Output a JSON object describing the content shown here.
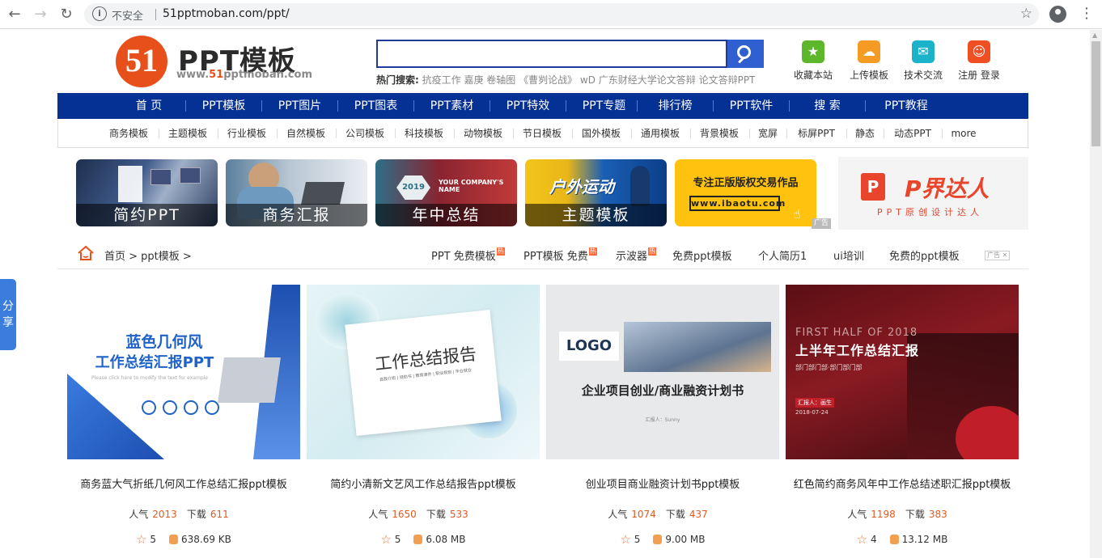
{
  "browser": {
    "security_label": "不安全",
    "url": "51pptmoban.com/ppt/"
  },
  "header": {
    "logo_mark": "51",
    "logo_title": "PPT模板",
    "logo_sub_prefix": "www.",
    "logo_sub_highlight": "51",
    "logo_sub_suffix": "pptmoban.com",
    "hot_label": "热门搜索:",
    "hot_terms": "抗疫工作 嘉庚 卷轴图 《曹刿论战》 wD 广东财经大学论文答辩 论文答辩PPT",
    "icons": [
      {
        "label": "收藏本站",
        "color": "#5cb82a",
        "icon": "star-icon",
        "glyph": "★"
      },
      {
        "label": "上传模板",
        "color": "#f59a23",
        "icon": "upload-cloud-icon",
        "glyph": "☁"
      },
      {
        "label": "技术交流",
        "color": "#1ab3c9",
        "icon": "chat-icon",
        "glyph": "✉"
      },
      {
        "label": "注册 登录",
        "color": "#f04e23",
        "icon": "user-icon",
        "glyph": "☺"
      }
    ]
  },
  "main_nav": [
    "首 页",
    "PPT模板",
    "PPT图片",
    "PPT图表",
    "PPT素材",
    "PPT特效",
    "PPT专题",
    "排行榜",
    "PPT软件",
    "搜 索",
    "PPT教程"
  ],
  "sub_nav": [
    "商务模板",
    "主题模板",
    "行业模板",
    "自然模板",
    "公司模板",
    "科技模板",
    "动物模板",
    "节日模板",
    "国外模板",
    "通用模板",
    "背景模板",
    "宽屏",
    "标屏PPT",
    "静态",
    "动态PPT",
    "more"
  ],
  "banners": [
    {
      "caption": "简约PPT"
    },
    {
      "caption": "商务汇报"
    },
    {
      "caption": "年中总结",
      "inner": "YOUR COMPANY'S NAME",
      "year": "2019"
    },
    {
      "caption": "主题模板",
      "inner": "户外运动"
    },
    {
      "caption": "",
      "headline": "专注正版版权交易作品",
      "site": "www.ibaotu.com",
      "ad": "广告"
    },
    {
      "caption": "",
      "brand": "P界达人",
      "slogan": "PPT原创设计达人"
    }
  ],
  "breadcrumb": {
    "text": "首页 > ppt模板 >",
    "keywords": [
      {
        "text": "PPT 免费模板",
        "hot": "热"
      },
      {
        "text": "PPT模板 免费",
        "hot": "热"
      },
      {
        "text": "示波器",
        "hot": "热"
      },
      {
        "text": "免费ppt模板",
        "hot": ""
      },
      {
        "text": "个人简历1",
        "hot": ""
      },
      {
        "text": "ui培训",
        "hot": ""
      },
      {
        "text": "免费的ppt模板",
        "hot": ""
      }
    ],
    "ad": "广告 ✕"
  },
  "share": {
    "label": "分享"
  },
  "cards": [
    {
      "thumb_title": "蓝色几何风",
      "thumb_title2": "工作总结汇报PPT",
      "thumb_sub": "Please click here to modify the text for example",
      "title": "商务蓝大气折纸几何风工作总结汇报ppt模板",
      "popularity_label": "人气",
      "popularity": "2013",
      "downloads_label": "下载",
      "downloads": "611",
      "rating": "5",
      "size": "638.69 KB"
    },
    {
      "thumb_title": "工作总结报告",
      "thumb_sub": "自我介绍 | 规划书 | 教育课件 | 职业规划 | 毕业就业",
      "title": "简约小清新文艺风工作总结报告ppt模板",
      "popularity_label": "人气",
      "popularity": "1650",
      "downloads_label": "下载",
      "downloads": "533",
      "rating": "5",
      "size": "6.08 MB"
    },
    {
      "thumb_logo": "LOGO",
      "thumb_title": "企业项目创业/商业融资计划书",
      "thumb_sub": "汇报人：Sunny",
      "title": "创业项目商业融资计划书ppt模板",
      "popularity_label": "人气",
      "popularity": "1074",
      "downloads_label": "下载",
      "downloads": "437",
      "rating": "5",
      "size": "9.00 MB"
    },
    {
      "thumb_en": "FIRST HALF OF 2018",
      "thumb_title": "上半年工作总结汇报",
      "thumb_sub": "部门部门部·部门部门部",
      "thumb_reporter": "汇报人：画生",
      "thumb_date": "2018-07-24",
      "title": "红色简约商务风年中工作总结述职汇报ppt模板",
      "popularity_label": "人气",
      "popularity": "1198",
      "downloads_label": "下载",
      "downloads": "383",
      "rating": "4",
      "size": "13.12 MB"
    }
  ]
}
